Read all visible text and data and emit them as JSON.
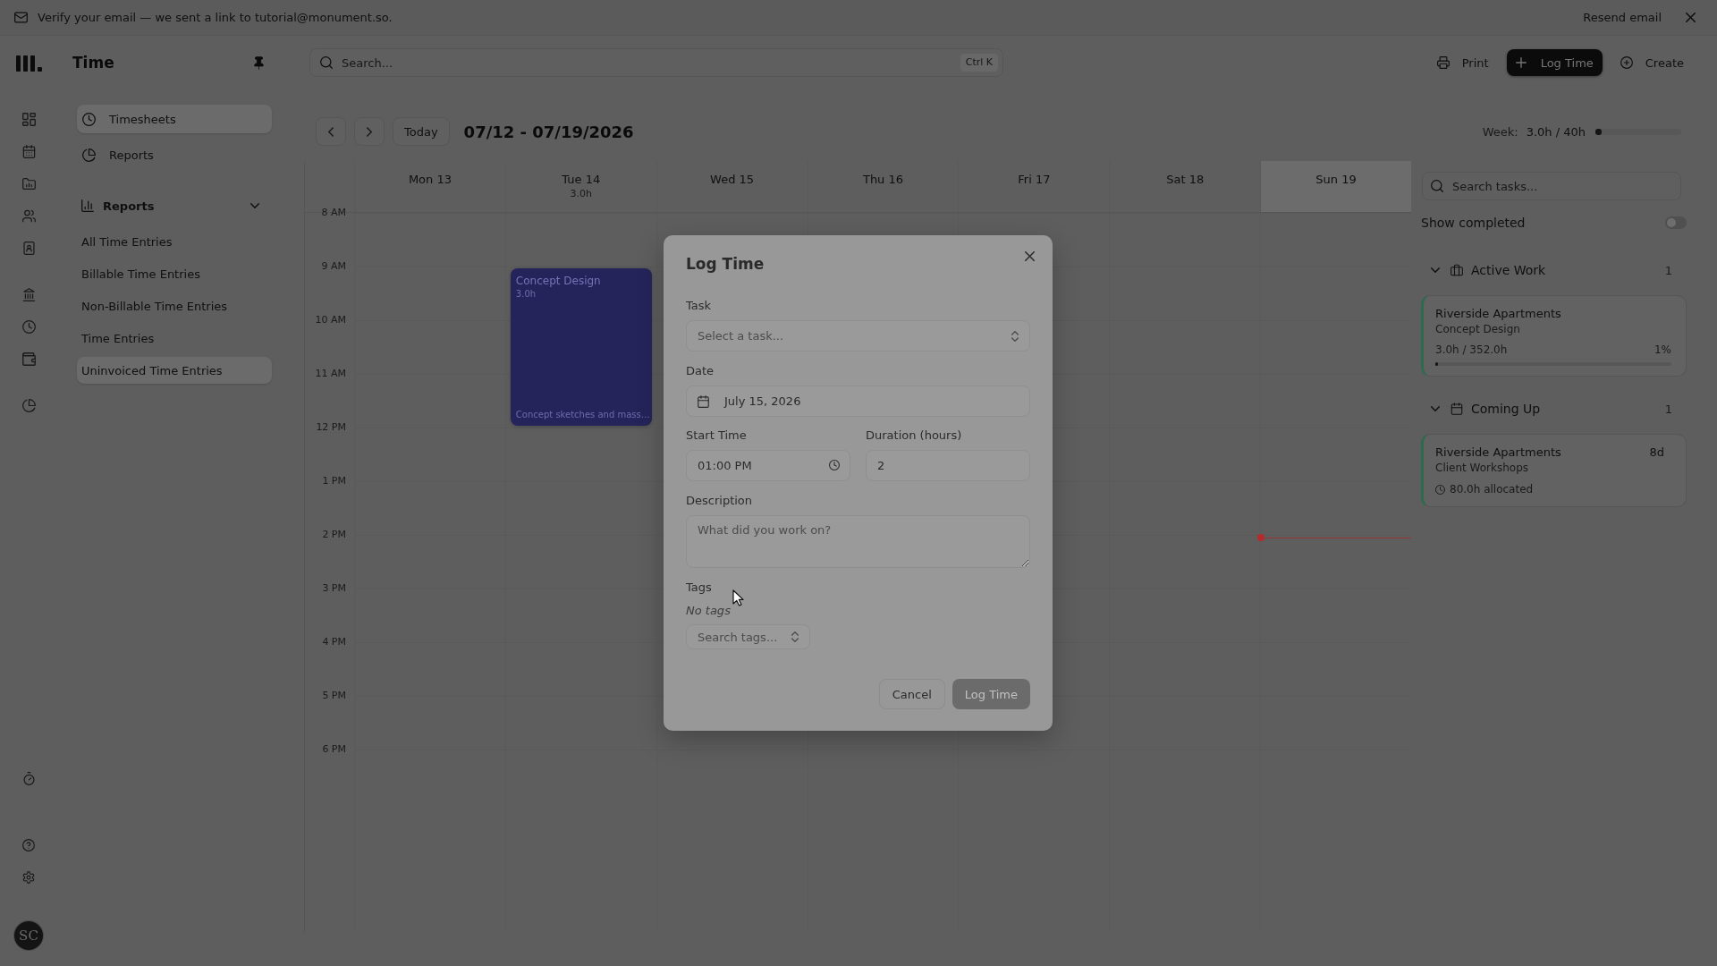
{
  "banner": {
    "message": "Verify your email — we sent a link to tutorial@monument.so.",
    "action": "Resend email"
  },
  "rail": {
    "avatar_initials": "SC"
  },
  "sidebar": {
    "title": "Time",
    "nav": [
      {
        "label": "Timesheets",
        "selected": true
      },
      {
        "label": "Reports",
        "selected": false
      }
    ],
    "section": {
      "label": "Reports",
      "expanded": true,
      "items": [
        {
          "label": "All Time Entries",
          "selected": false
        },
        {
          "label": "Billable Time Entries",
          "selected": false
        },
        {
          "label": "Non-Billable Time Entries",
          "selected": false
        },
        {
          "label": "Time Entries",
          "selected": false
        },
        {
          "label": "Uninvoiced Time Entries",
          "selected": true
        }
      ]
    }
  },
  "topbar": {
    "search": {
      "placeholder": "Search...",
      "shortcut": "Ctrl K"
    },
    "actions": [
      {
        "label": "Print",
        "kind": "ghost"
      },
      {
        "label": "Log Time",
        "kind": "primary"
      },
      {
        "label": "Create",
        "kind": "ghost"
      }
    ]
  },
  "calendar": {
    "today_button": "Today",
    "range": "07/12 - 07/19/2026",
    "week": {
      "label": "Week:",
      "total": "3.0h / 40h",
      "level": 0.075
    },
    "days": [
      {
        "label": "Mon 13",
        "today": false
      },
      {
        "label": "Tue 14",
        "today": false,
        "total": "3.0h",
        "slots": [
          {
            "kind": "free"
          },
          {
            "kind": "entry",
            "title": "Concept Design",
            "duration": "3.0h",
            "note": "Concept sketches and mass…"
          }
        ]
      },
      {
        "label": "Wed 15",
        "today": false
      },
      {
        "label": "Thu 16",
        "today": false
      },
      {
        "label": "Fri 17",
        "today": false
      },
      {
        "label": "Sat 18",
        "today": false
      },
      {
        "label": "Sun 19",
        "today": true,
        "slots": [
          {
            "kind": "free"
          },
          {
            "kind": "free"
          },
          {
            "kind": "free"
          },
          {
            "kind": "free"
          },
          {
            "kind": "free"
          },
          {
            "kind": "free"
          },
          {
            "kind": "now"
          }
        ]
      }
    ],
    "hours": [
      "8 AM",
      "9 AM",
      "10 AM",
      "11 AM",
      "12 PM",
      "1 PM",
      "2 PM",
      "3 PM",
      "4 PM",
      "5 PM",
      "6 PM"
    ]
  },
  "tasks": {
    "search": {
      "placeholder": "Search tasks..."
    },
    "show_completed": {
      "label": "Show completed",
      "on": false
    },
    "groups": [
      {
        "title": "Active Work",
        "count": "1",
        "expanded": true,
        "cards": [
          {
            "kind": "progress",
            "project": "Riverside Apartments",
            "task": "Concept Design",
            "hours": "3.0h / 352.0h",
            "percent": "1%",
            "level": 0.01
          }
        ]
      },
      {
        "title": "Coming Up",
        "count": "1",
        "expanded": true,
        "cards": [
          {
            "kind": "upcoming",
            "project": "Riverside Apartments",
            "task": "Client Workshops",
            "due": "8d",
            "allocated": "80.0h allocated"
          }
        ]
      }
    ]
  },
  "dialog": {
    "title": "Log Time",
    "task": {
      "label": "Task",
      "placeholder": "Select a task..."
    },
    "date": {
      "label": "Date",
      "value": "July 15, 2026"
    },
    "start_time": {
      "label": "Start Time",
      "value": "01:00 PM"
    },
    "duration": {
      "label": "Duration (hours)",
      "value": "2"
    },
    "description": {
      "label": "Description",
      "placeholder": "What did you work on?"
    },
    "tags": {
      "label": "Tags",
      "empty_text": "No tags",
      "placeholder": "Search tags..."
    },
    "buttons": [
      {
        "label": "Cancel",
        "kind": "secondary",
        "disabled": false
      },
      {
        "label": "Log Time",
        "kind": "primary",
        "disabled": true
      }
    ]
  }
}
